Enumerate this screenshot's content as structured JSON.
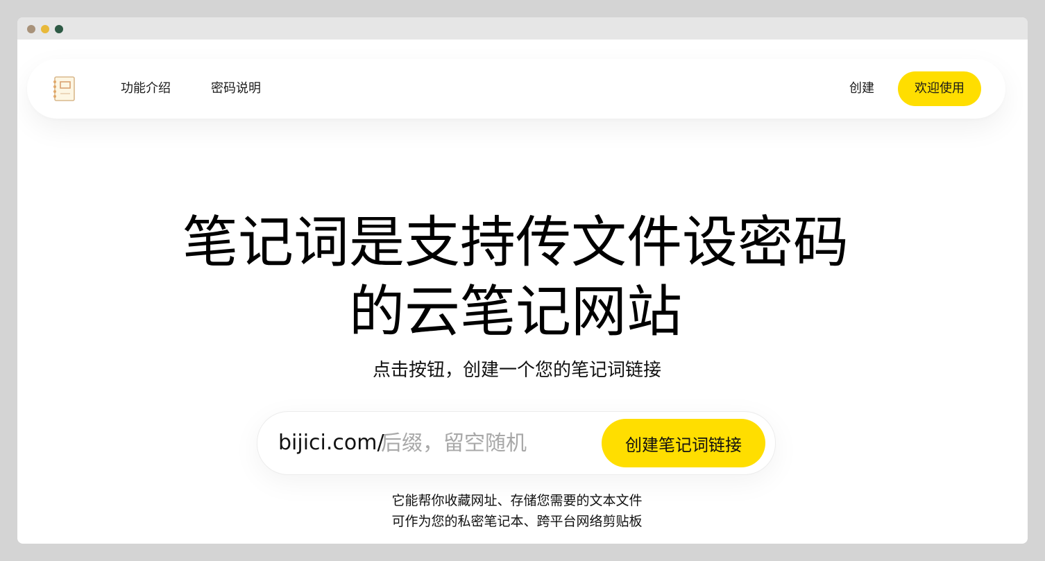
{
  "window": {
    "controls": [
      {
        "name": "close",
        "color": "#a8927a"
      },
      {
        "name": "minimize",
        "color": "#e8b93a"
      },
      {
        "name": "maximize",
        "color": "#2e5a45"
      }
    ]
  },
  "navbar": {
    "logo_icon": "notebook-icon",
    "links": [
      "功能介绍",
      "密码说明"
    ],
    "create_label": "创建",
    "welcome_label": "欢迎使用",
    "accent_color": "#ffde00"
  },
  "hero": {
    "title_lines": [
      "笔记词是支持传文件设密码",
      "的云笔记网站"
    ],
    "subtitle": "点击按钮，创建一个您的笔记词链接"
  },
  "url_form": {
    "prefix": "bijici.com/",
    "placeholder": "后缀，留空随机",
    "value": "",
    "button_label": "创建笔记词链接"
  },
  "description": {
    "lines": [
      "它能帮你收藏网址、存储您需要的文本文件",
      "可作为您的私密笔记本、跨平台网络剪贴板"
    ]
  }
}
